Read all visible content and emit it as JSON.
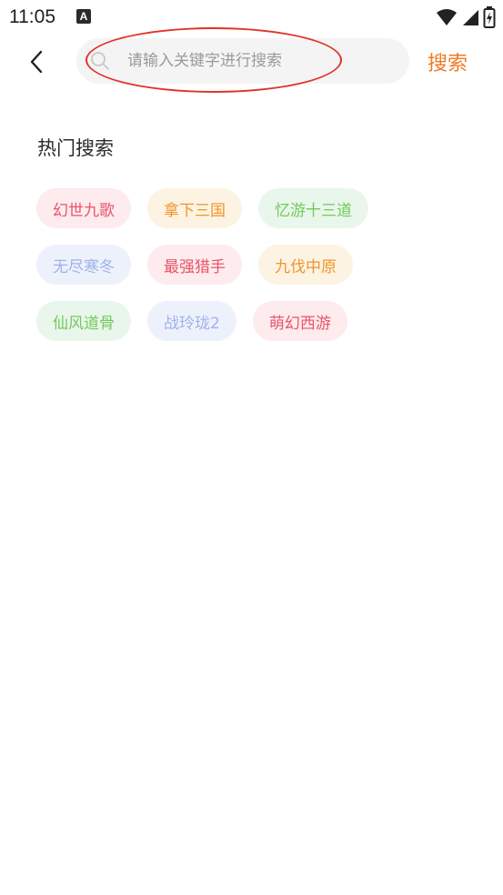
{
  "status_bar": {
    "time": "11:05",
    "app_icon_letter": "A"
  },
  "header": {
    "search_placeholder": "请输入关键字进行搜索",
    "search_value": "",
    "search_button_label": "搜索"
  },
  "hot_search": {
    "title": "热门搜索",
    "rows": [
      [
        {
          "label": "幻世九歌",
          "color": "red"
        },
        {
          "label": "拿下三国",
          "color": "orange"
        },
        {
          "label": "忆游十三道",
          "color": "green"
        }
      ],
      [
        {
          "label": "无尽寒冬",
          "color": "blue"
        },
        {
          "label": "最强猎手",
          "color": "red"
        },
        {
          "label": "九伐中原",
          "color": "orange"
        }
      ],
      [
        {
          "label": "仙风道骨",
          "color": "green"
        },
        {
          "label": "战玲珑2",
          "color": "blue"
        },
        {
          "label": "萌幻西游",
          "color": "red"
        }
      ]
    ]
  },
  "colors": {
    "accent": "#f07a22",
    "highlight_circle": "#e0342b",
    "tag_red_bg": "#fdebee",
    "tag_red_text": "#e8546a",
    "tag_orange_bg": "#fdf3e2",
    "tag_orange_text": "#f0952b",
    "tag_green_bg": "#e9f6ec",
    "tag_green_text": "#74c95a",
    "tag_blue_bg": "#edf1fb",
    "tag_blue_text": "#9fb3ea"
  },
  "icons": {
    "back": "chevron-left-icon",
    "search": "search-icon",
    "wifi": "wifi-icon",
    "signal": "signal-icon",
    "battery": "battery-icon",
    "notification": "app-notification-icon"
  }
}
